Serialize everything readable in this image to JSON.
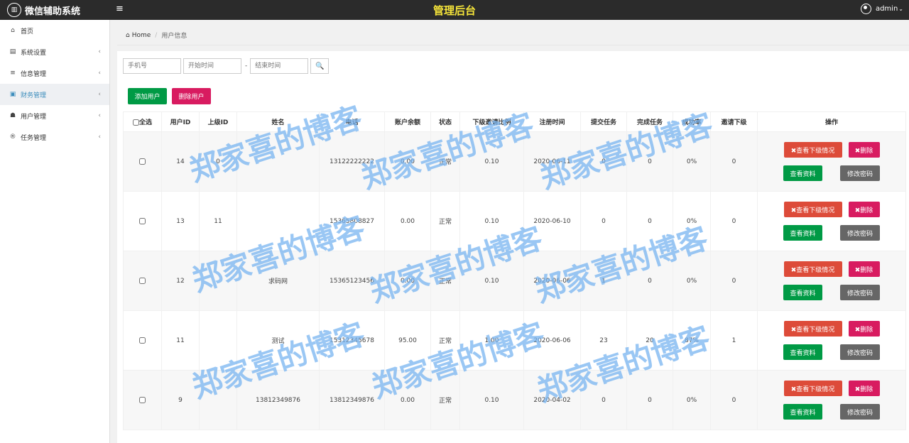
{
  "header": {
    "logo_text": "微信辅助系统",
    "menu_icon": "≡",
    "center_title": "管理后台",
    "user_name": "admin"
  },
  "sidebar": {
    "items": [
      {
        "icon": "home-icon",
        "glyph": "⌂",
        "label": "首页"
      },
      {
        "icon": "settings-icon",
        "glyph": "▤",
        "label": "系统设置"
      },
      {
        "icon": "list-icon",
        "glyph": "≡",
        "label": "信息管理"
      },
      {
        "icon": "money-icon",
        "glyph": "▣",
        "label": "财务管理"
      },
      {
        "icon": "users-icon",
        "glyph": "☗",
        "label": "用户管理"
      },
      {
        "icon": "task-icon",
        "glyph": "®",
        "label": "任务管理"
      }
    ]
  },
  "breadcrumb": {
    "home": "Home",
    "current": "用户信息"
  },
  "search": {
    "phone_placeholder": "手机号",
    "start_placeholder": "开始时间",
    "end_placeholder": "结束时间",
    "dash": "-"
  },
  "toolbar": {
    "add_label": "添加用户",
    "delete_label": "删除用户"
  },
  "table": {
    "headers": [
      "全选",
      "用户ID",
      "上级ID",
      "姓名",
      "电话",
      "账户余额",
      "状态",
      "下级邀请比例",
      "注册时间",
      "提交任务",
      "完成任务",
      "成功率",
      "邀请下级",
      "操作"
    ],
    "rows": [
      {
        "id": "14",
        "parent": "0",
        "name": "",
        "phone": "13122222222",
        "balance": "0.00",
        "status": "正常",
        "ratio": "0.10",
        "date": "2020-06-11",
        "submitted": "0",
        "done": "0",
        "rate": "0%",
        "invited": "0"
      },
      {
        "id": "13",
        "parent": "11",
        "name": "",
        "phone": "15365808827",
        "balance": "0.00",
        "status": "正常",
        "ratio": "0.10",
        "date": "2020-06-10",
        "submitted": "0",
        "done": "0",
        "rate": "0%",
        "invited": "0"
      },
      {
        "id": "12",
        "parent": "",
        "name": "求码网",
        "phone": "15365123456",
        "balance": "0.00",
        "status": "正常",
        "ratio": "0.10",
        "date": "2020-06-06",
        "submitted": "1",
        "done": "0",
        "rate": "0%",
        "invited": "0"
      },
      {
        "id": "11",
        "parent": "",
        "name": "测试",
        "phone": "15312345678",
        "balance": "95.00",
        "status": "正常",
        "ratio": "1.00",
        "date": "2020-06-06",
        "submitted": "23",
        "done": "20",
        "rate": "87%",
        "invited": "1"
      },
      {
        "id": "9",
        "parent": "",
        "name": "13812349876",
        "phone": "13812349876",
        "balance": "0.00",
        "status": "正常",
        "ratio": "0.10",
        "date": "2020-04-02",
        "submitted": "0",
        "done": "0",
        "rate": "0%",
        "invited": "0"
      }
    ],
    "ops": {
      "view_sub": "✖查看下级情况",
      "delete": "✖删除",
      "view_profile": "查看资料",
      "change_pwd": "修改密码"
    }
  },
  "watermark": "郑家喜的博客"
}
